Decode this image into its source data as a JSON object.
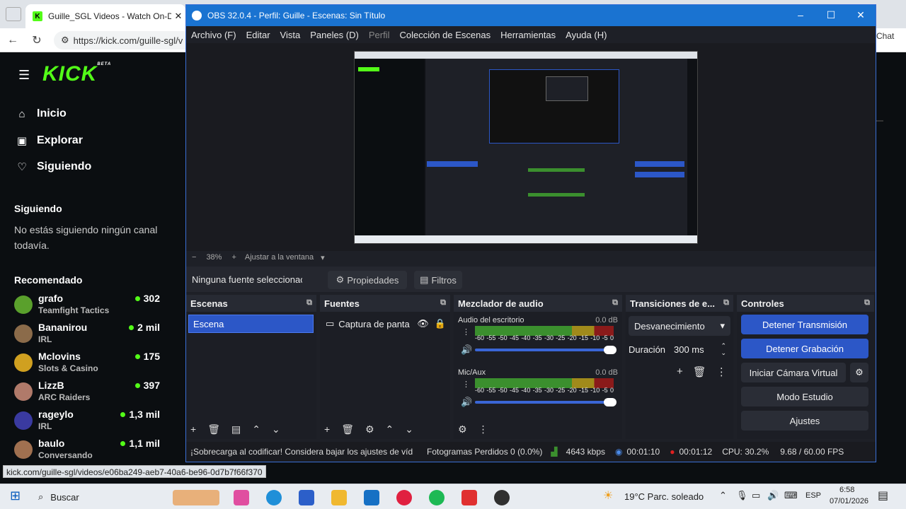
{
  "browser": {
    "tab_title": "Guille_SGL Videos - Watch On-Der",
    "tab_close": "✕",
    "url": "https://kick.com/guille-sgl/v",
    "chat_label": "Chat",
    "status_url": "kick.com/guille-sgl/videos/e06ba249-aeb7-40a6-be96-0d7b7f66f370"
  },
  "kick": {
    "logo": "KICK",
    "logo_beta": "BETA",
    "nav": [
      {
        "label": "Inicio",
        "icon": "home-icon"
      },
      {
        "label": "Explorar",
        "icon": "browse-icon"
      },
      {
        "label": "Siguiendo",
        "icon": "heart-icon"
      }
    ],
    "following_heading": "Siguiendo",
    "following_empty": "No estás siguiendo ningún canal todavía.",
    "recommended_heading": "Recomendado",
    "recommended": [
      {
        "name": "grafo",
        "category": "Teamfight Tactics",
        "viewers": "302",
        "color": "#5aa02c"
      },
      {
        "name": "Bananirou",
        "category": "IRL",
        "viewers": "2 mil",
        "color": "#8b6b4a"
      },
      {
        "name": "Mclovins",
        "category": "Slots & Casino",
        "viewers": "175",
        "color": "#d0a020"
      },
      {
        "name": "LizzB",
        "category": "ARC Raiders",
        "viewers": "397",
        "color": "#b07a6a"
      },
      {
        "name": "rageylo",
        "category": "IRL",
        "viewers": "1,3 mil",
        "color": "#3a3aa0"
      },
      {
        "name": "baulo",
        "category": "Conversando",
        "viewers": "1,1 mil",
        "color": "#a07050"
      }
    ]
  },
  "obs": {
    "title": "OBS 32.0.4 - Perfil: Guille - Escenas: Sin Título",
    "menu": [
      "Archivo (F)",
      "Editar",
      "Vista",
      "Paneles (D)",
      "Perfil",
      "Colección de Escenas",
      "Herramientas",
      "Ayuda (H)"
    ],
    "zoom": "38%",
    "zoom_fit": "Ajustar a la ventana",
    "no_source": "Ninguna fuente seleccionac",
    "properties": "Propiedades",
    "filters": "Filtros",
    "docks": {
      "scenes": "Escenas",
      "sources": "Fuentes",
      "mixer": "Mezclador de audio",
      "transitions": "Transiciones de e...",
      "controls": "Controles"
    },
    "scene_item": "Escena",
    "source_item": "Captura de panta",
    "mixer_channels": [
      {
        "name": "Audio del escritorio",
        "db": "0.0 dB"
      },
      {
        "name": "Mic/Aux",
        "db": "0.0 dB"
      }
    ],
    "meter_scale": [
      "-60",
      "-55",
      "-50",
      "-45",
      "-40",
      "-35",
      "-30",
      "-25",
      "-20",
      "-15",
      "-10",
      "-5",
      "0"
    ],
    "transition": "Desvanecimiento",
    "duration_label": "Duración",
    "duration_value": "300 ms",
    "controls": {
      "stop_stream": "Detener Transmisión",
      "stop_record": "Detener Grabación",
      "virtual_cam": "Iniciar Cámara Virtual",
      "studio_mode": "Modo Estudio",
      "settings": "Ajustes"
    },
    "status": {
      "warning": "¡Sobrecarga al codificar! Considera bajar los ajustes de víd",
      "dropped": "Fotogramas Perdidos 0 (0.0%)",
      "kbps": "4643 kbps",
      "stream_time": "00:01:10",
      "rec_time": "00:01:12",
      "cpu": "CPU: 30.2%",
      "fps": "9.68 / 60.00 FPS"
    }
  },
  "taskbar": {
    "search": "Buscar",
    "weather": "19°C  Parc. soleado",
    "lang": "ESP",
    "time": "6:58",
    "date": "07/01/2026"
  }
}
